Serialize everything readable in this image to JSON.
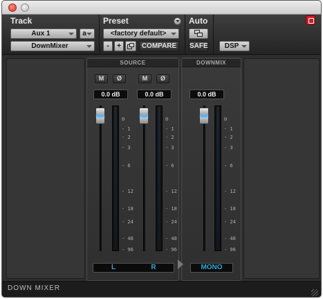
{
  "window": {
    "title_controls": [
      "close",
      "minimize"
    ]
  },
  "header": {
    "track_label": "Track",
    "preset_label": "Preset",
    "auto_label": "Auto",
    "track_name": "Aux 1",
    "track_channel": "a",
    "plugin_name": "DownMixer",
    "preset_name": "<factory default>",
    "preset_minus": "-",
    "preset_plus": "+",
    "compare_label": "COMPARE",
    "safe_label": "SAFE",
    "dsp_label": "DSP"
  },
  "source": {
    "title": "SOURCE",
    "channels": [
      {
        "mute": "M",
        "phase": "Ø",
        "gain": "0.0 dB",
        "label": "L"
      },
      {
        "mute": "M",
        "phase": "Ø",
        "gain": "0.0 dB",
        "label": "R"
      }
    ]
  },
  "downmix": {
    "title": "DOWNMIX",
    "gain": "0.0 dB",
    "label": "MONO"
  },
  "scale_ticks": [
    "0",
    "- 1",
    "- 2",
    "- 3",
    "- 6",
    "- 12",
    "- 18",
    "- 24",
    "- 48",
    "- 96"
  ],
  "footer": {
    "title": "DOWN MIXER"
  },
  "colors": {
    "accent": "#31a7d8",
    "bypass": "#c81e2a",
    "fader_led": "#4fb7ff"
  }
}
